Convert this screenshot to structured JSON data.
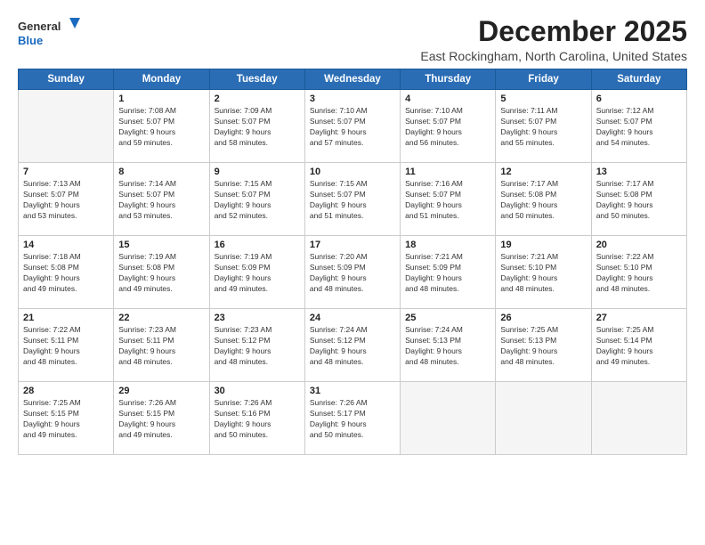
{
  "logo": {
    "line1": "General",
    "line2": "Blue"
  },
  "title": "December 2025",
  "location": "East Rockingham, North Carolina, United States",
  "days_header": [
    "Sunday",
    "Monday",
    "Tuesday",
    "Wednesday",
    "Thursday",
    "Friday",
    "Saturday"
  ],
  "weeks": [
    [
      {
        "day": "",
        "info": ""
      },
      {
        "day": "1",
        "info": "Sunrise: 7:08 AM\nSunset: 5:07 PM\nDaylight: 9 hours\nand 59 minutes."
      },
      {
        "day": "2",
        "info": "Sunrise: 7:09 AM\nSunset: 5:07 PM\nDaylight: 9 hours\nand 58 minutes."
      },
      {
        "day": "3",
        "info": "Sunrise: 7:10 AM\nSunset: 5:07 PM\nDaylight: 9 hours\nand 57 minutes."
      },
      {
        "day": "4",
        "info": "Sunrise: 7:10 AM\nSunset: 5:07 PM\nDaylight: 9 hours\nand 56 minutes."
      },
      {
        "day": "5",
        "info": "Sunrise: 7:11 AM\nSunset: 5:07 PM\nDaylight: 9 hours\nand 55 minutes."
      },
      {
        "day": "6",
        "info": "Sunrise: 7:12 AM\nSunset: 5:07 PM\nDaylight: 9 hours\nand 54 minutes."
      }
    ],
    [
      {
        "day": "7",
        "info": "Sunrise: 7:13 AM\nSunset: 5:07 PM\nDaylight: 9 hours\nand 53 minutes."
      },
      {
        "day": "8",
        "info": "Sunrise: 7:14 AM\nSunset: 5:07 PM\nDaylight: 9 hours\nand 53 minutes."
      },
      {
        "day": "9",
        "info": "Sunrise: 7:15 AM\nSunset: 5:07 PM\nDaylight: 9 hours\nand 52 minutes."
      },
      {
        "day": "10",
        "info": "Sunrise: 7:15 AM\nSunset: 5:07 PM\nDaylight: 9 hours\nand 51 minutes."
      },
      {
        "day": "11",
        "info": "Sunrise: 7:16 AM\nSunset: 5:07 PM\nDaylight: 9 hours\nand 51 minutes."
      },
      {
        "day": "12",
        "info": "Sunrise: 7:17 AM\nSunset: 5:08 PM\nDaylight: 9 hours\nand 50 minutes."
      },
      {
        "day": "13",
        "info": "Sunrise: 7:17 AM\nSunset: 5:08 PM\nDaylight: 9 hours\nand 50 minutes."
      }
    ],
    [
      {
        "day": "14",
        "info": "Sunrise: 7:18 AM\nSunset: 5:08 PM\nDaylight: 9 hours\nand 49 minutes."
      },
      {
        "day": "15",
        "info": "Sunrise: 7:19 AM\nSunset: 5:08 PM\nDaylight: 9 hours\nand 49 minutes."
      },
      {
        "day": "16",
        "info": "Sunrise: 7:19 AM\nSunset: 5:09 PM\nDaylight: 9 hours\nand 49 minutes."
      },
      {
        "day": "17",
        "info": "Sunrise: 7:20 AM\nSunset: 5:09 PM\nDaylight: 9 hours\nand 48 minutes."
      },
      {
        "day": "18",
        "info": "Sunrise: 7:21 AM\nSunset: 5:09 PM\nDaylight: 9 hours\nand 48 minutes."
      },
      {
        "day": "19",
        "info": "Sunrise: 7:21 AM\nSunset: 5:10 PM\nDaylight: 9 hours\nand 48 minutes."
      },
      {
        "day": "20",
        "info": "Sunrise: 7:22 AM\nSunset: 5:10 PM\nDaylight: 9 hours\nand 48 minutes."
      }
    ],
    [
      {
        "day": "21",
        "info": "Sunrise: 7:22 AM\nSunset: 5:11 PM\nDaylight: 9 hours\nand 48 minutes."
      },
      {
        "day": "22",
        "info": "Sunrise: 7:23 AM\nSunset: 5:11 PM\nDaylight: 9 hours\nand 48 minutes."
      },
      {
        "day": "23",
        "info": "Sunrise: 7:23 AM\nSunset: 5:12 PM\nDaylight: 9 hours\nand 48 minutes."
      },
      {
        "day": "24",
        "info": "Sunrise: 7:24 AM\nSunset: 5:12 PM\nDaylight: 9 hours\nand 48 minutes."
      },
      {
        "day": "25",
        "info": "Sunrise: 7:24 AM\nSunset: 5:13 PM\nDaylight: 9 hours\nand 48 minutes."
      },
      {
        "day": "26",
        "info": "Sunrise: 7:25 AM\nSunset: 5:13 PM\nDaylight: 9 hours\nand 48 minutes."
      },
      {
        "day": "27",
        "info": "Sunrise: 7:25 AM\nSunset: 5:14 PM\nDaylight: 9 hours\nand 49 minutes."
      }
    ],
    [
      {
        "day": "28",
        "info": "Sunrise: 7:25 AM\nSunset: 5:15 PM\nDaylight: 9 hours\nand 49 minutes."
      },
      {
        "day": "29",
        "info": "Sunrise: 7:26 AM\nSunset: 5:15 PM\nDaylight: 9 hours\nand 49 minutes."
      },
      {
        "day": "30",
        "info": "Sunrise: 7:26 AM\nSunset: 5:16 PM\nDaylight: 9 hours\nand 50 minutes."
      },
      {
        "day": "31",
        "info": "Sunrise: 7:26 AM\nSunset: 5:17 PM\nDaylight: 9 hours\nand 50 minutes."
      },
      {
        "day": "",
        "info": ""
      },
      {
        "day": "",
        "info": ""
      },
      {
        "day": "",
        "info": ""
      }
    ]
  ]
}
